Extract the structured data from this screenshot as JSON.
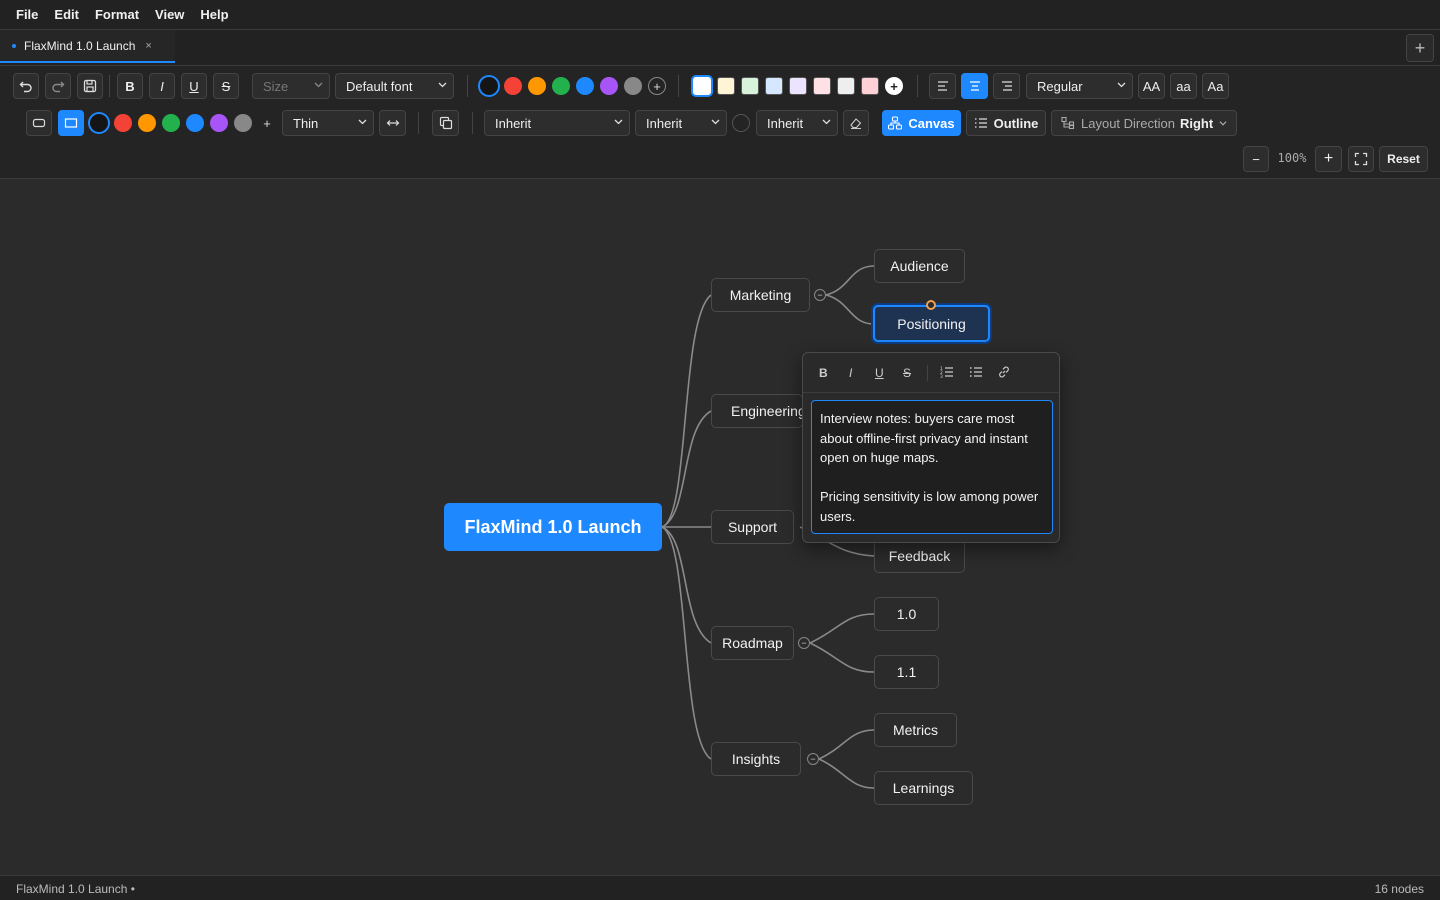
{
  "menu": [
    "File",
    "Edit",
    "Format",
    "View",
    "Help"
  ],
  "tab": {
    "title": "FlaxMind 1.0 Launch",
    "close_glyph": "×",
    "add_glyph": "+"
  },
  "toolbar1": {
    "bold": "B",
    "italic": "I",
    "underline": "U",
    "strike": "S",
    "size_placeholder": "Size",
    "font": "Default font",
    "text_colors": [
      "#151515",
      "#f44336",
      "#ff9800",
      "#22b14c",
      "#1e88ff",
      "#a855f7",
      "#888888"
    ],
    "bg_colors": [
      "#ffffff",
      "#fff5d6",
      "#d9f2dc",
      "#d6e8ff",
      "#ece3ff",
      "#ffe0e4",
      "#eeeeee",
      "#ffd1d6"
    ],
    "add_glyph": "+",
    "weight": "Regular",
    "case_upper": "AA",
    "case_lower": "aa",
    "case_title": "Aa"
  },
  "toolbar2": {
    "border_colors": [
      "#151515",
      "#f44336",
      "#ff9800",
      "#22b14c",
      "#1e88ff",
      "#a855f7",
      "#888888"
    ],
    "add_glyph": "+",
    "line_width": "Thin",
    "inherit_1": "Inherit",
    "inherit_2": "Inherit",
    "inherit_3": "Inherit",
    "canvas_label": "Canvas",
    "outline_label": "Outline",
    "layout_label": "Layout Direction",
    "layout_value": "Right"
  },
  "zoom": {
    "minus": "−",
    "value": "100%",
    "plus": "+",
    "reset": "Reset"
  },
  "map": {
    "root": "FlaxMind 1.0 Launch",
    "branches": [
      "Marketing",
      "Engineering",
      "Support",
      "Roadmap",
      "Insights"
    ],
    "leaves": {
      "audience": "Audience",
      "positioning": "Positioning",
      "feedback": "Feedback",
      "v10": "1.0",
      "v11": "1.1",
      "metrics": "Metrics",
      "learnings": "Learnings"
    },
    "collapse_glyph": "−"
  },
  "note": {
    "tools": {
      "bold": "B",
      "italic": "I",
      "underline": "U",
      "strike": "S"
    },
    "text": "Interview notes: buyers care most about offline-first privacy and instant open on huge maps.\n\nPricing sensitivity is low among power users."
  },
  "status": {
    "left": "FlaxMind 1.0 Launch •",
    "right": "16 nodes"
  },
  "colors": {
    "accent": "#1e88ff",
    "background": "#2b2b2b"
  }
}
